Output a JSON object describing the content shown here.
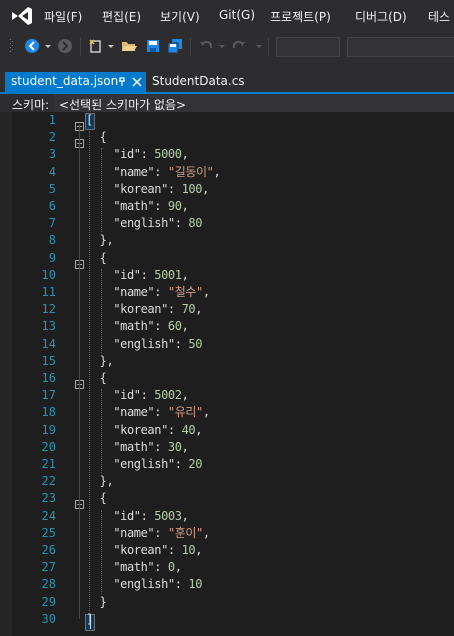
{
  "menu": {
    "items": [
      "파일(F)",
      "편집(E)",
      "보기(V)",
      "Git(G)",
      "프로젝트(P)",
      "디버그(D)",
      "테스"
    ]
  },
  "tabs": [
    {
      "label": "student_data.json",
      "active": true,
      "pinned": true
    },
    {
      "label": "StudentData.cs",
      "active": false
    }
  ],
  "schema": {
    "label": "스키마:",
    "value": "<선택된 스키마가 없음>"
  },
  "editor": {
    "lines": [
      "[",
      "  {",
      "    \"id\": 5000,",
      "    \"name\": \"길동이\",",
      "    \"korean\": 100,",
      "    \"math\": 90,",
      "    \"english\": 80",
      "  },",
      "  {",
      "    \"id\": 5001,",
      "    \"name\": \"철수\",",
      "    \"korean\": 70,",
      "    \"math\": 60,",
      "    \"english\": 50",
      "  },",
      "  {",
      "    \"id\": 5002,",
      "    \"name\": \"유리\",",
      "    \"korean\": 40,",
      "    \"math\": 30,",
      "    \"english\": 20",
      "  },",
      "  {",
      "    \"id\": 5003,",
      "    \"name\": \"훈이\",",
      "    \"korean\": 10,",
      "    \"math\": 0,",
      "    \"english\": 10",
      "  }",
      "]"
    ]
  },
  "colors": {
    "accent": "#007acc",
    "background": "#1e1e1e",
    "chrome": "#2d2d30",
    "line_number": "#2b91af",
    "json_key": "#dcdcdc",
    "json_string": "#d69d85",
    "json_number": "#b5cea8"
  }
}
